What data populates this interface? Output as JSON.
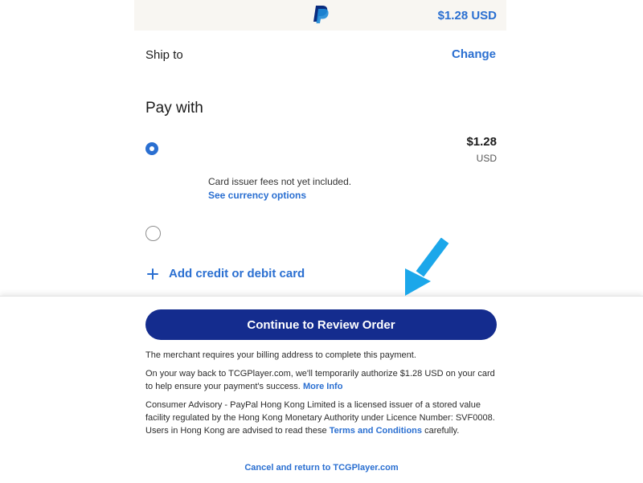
{
  "header": {
    "logo_icon": "paypal-logo-icon",
    "amount": "$1.28 USD"
  },
  "shipping": {
    "label": "Ship to",
    "change_label": "Change"
  },
  "payment": {
    "heading": "Pay with",
    "selected_option": {
      "amount": "$1.28",
      "currency": "USD",
      "note": "Card issuer fees not yet included.",
      "currency_link": "See currency options"
    },
    "add_card_label": "Add credit or debit card",
    "add_icon": "plus-icon"
  },
  "footer": {
    "continue_label": "Continue to Review Order",
    "billing_note": "The merchant requires your billing address to complete this payment.",
    "authorize_note": "On your way back to TCGPlayer.com, we'll temporarily authorize $1.28 USD on your card to help ensure your payment's success.",
    "more_info_link": "More Info",
    "advisory_text": "Consumer Advisory - PayPal Hong Kong Limited is a licensed issuer of a stored value facility regulated by the Hong Kong Monetary Authority under Licence Number: SVF0008. Users in Hong Kong are advised to read these",
    "terms_link": "Terms and Conditions",
    "advisory_suffix": "carefully.",
    "cancel_label": "Cancel and return to TCGPlayer.com"
  },
  "annotation": {
    "arrow_icon": "arrow-pointer-icon",
    "arrow_color": "#1ba7ea"
  },
  "colors": {
    "accent": "#2a6fd1",
    "primary_button": "#142c8e",
    "header_background": "#f8f6f2"
  }
}
